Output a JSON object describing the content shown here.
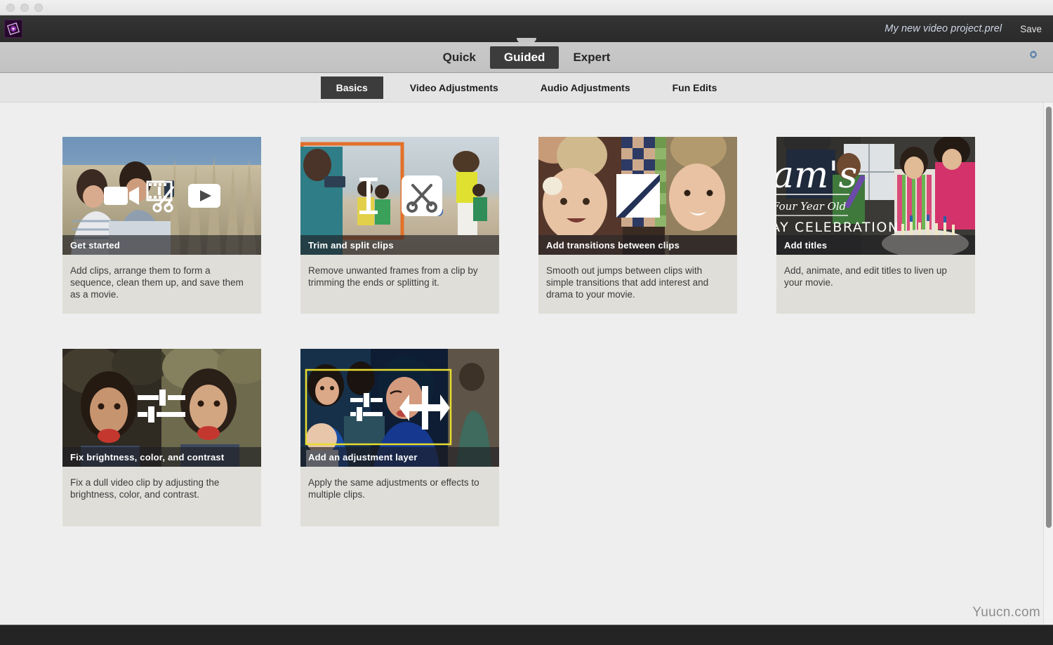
{
  "window": {
    "traffic_lights": [
      "close",
      "minimize",
      "zoom"
    ]
  },
  "titlebar": {
    "logo_name": "premiere-elements-logo",
    "project_title": "My new video project.prel",
    "save_label": "Save"
  },
  "mode_bar": {
    "tabs": [
      {
        "label": "Quick",
        "active": false
      },
      {
        "label": "Guided",
        "active": true
      },
      {
        "label": "Expert",
        "active": false
      }
    ],
    "settings_icon": "gear-icon",
    "gear_color": "#4f79a8"
  },
  "sub_tabs": [
    {
      "label": "Basics",
      "active": true
    },
    {
      "label": "Video Adjustments",
      "active": false
    },
    {
      "label": "Audio Adjustments",
      "active": false
    },
    {
      "label": "Fun Edits",
      "active": false
    }
  ],
  "cards": [
    {
      "caption": "Get started",
      "description": "Add clips, arrange them to form a sequence, clean them up, and save them as a movie.",
      "overlay_icons": [
        "video-camera-icon",
        "film-scissors-icon",
        "play-icon"
      ]
    },
    {
      "caption": "Trim and split clips",
      "description": "Remove unwanted frames from a clip by trimming the ends or splitting it.",
      "overlay_icons": [
        "trim-handle-icon",
        "scissors-icon"
      ]
    },
    {
      "caption": "Add transitions between clips",
      "description": "Smooth out jumps between clips with simple transitions that add interest and drama to your movie.",
      "overlay_icons": [
        "diagonal-wipe-icon"
      ]
    },
    {
      "caption": "Add titles",
      "description": "Add, animate, and edit titles to liven up your movie.",
      "overlay_text": [
        "am's",
        "Four Year Old",
        "AY CELEBRATION"
      ],
      "overlay_icons": []
    },
    {
      "caption": "Fix brightness, color, and contrast",
      "description": "Fix a dull video clip by adjusting the brightness, color, and contrast.",
      "overlay_icons": [
        "sliders-icon"
      ]
    },
    {
      "caption": "Add an adjustment layer",
      "description": "Apply the same adjustments or effects to multiple clips.",
      "overlay_icons": [
        "sliders-small-icon",
        "expand-arrows-icon"
      ]
    }
  ],
  "scrollbar": {
    "name": "vertical-scrollbar"
  },
  "watermark": {
    "text": "Yuucn.com"
  }
}
